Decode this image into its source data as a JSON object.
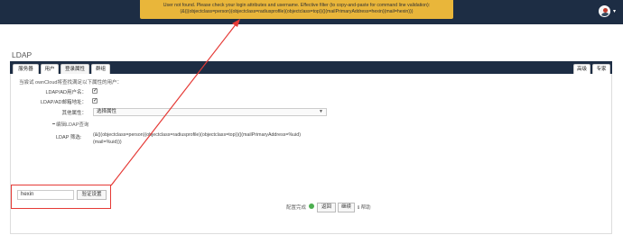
{
  "toast": {
    "line1": "User not found. Please check your login attributes and username. Effective filter (to copy-and-paste for command line validation):",
    "line2": "(&(|(objectclass=person)(objectclass=radiusprofile)(objectclass=top))(|(mailPrimaryAddress=hexin)(mail=hexin)))"
  },
  "header": {
    "user_caret": "▾"
  },
  "section": {
    "title": "LDAP"
  },
  "tabs": {
    "server": "服务器",
    "users": "用户",
    "login": "登录属性",
    "groups": "群组",
    "advanced": "高级",
    "expert": "专家"
  },
  "login_attrs": {
    "intro": "当尝试 ownCloud将查找满足以下属性的用户：",
    "ldap_ad_username_label": "LDAP/AD用户名：",
    "ldap_ad_username_checked": true,
    "ldap_ad_email_label": "LDAP/AD邮箱地址：",
    "ldap_ad_email_checked": true,
    "other_attrs_label": "其他属性：",
    "other_attrs_value": "选择属性",
    "edit_filter_link": "编辑LDAP查询",
    "ldap_filter_label": "LDAP 筛选:",
    "ldap_filter_line1": "(&(|(objectclass=person)(objectclass=radiusprofile)(objectclass=top))(|(mailPrimaryAddress=%uid)",
    "ldap_filter_line2": "(mail=%uid)))",
    "test_login_value": "hexin",
    "verify_button": "验证设置"
  },
  "footer": {
    "status_text": "配置完成",
    "back_button": "返回",
    "continue_button": "继续",
    "help_link": "帮助",
    "status_color": "#4caf50"
  },
  "colors": {
    "header_bg": "#1d2d44",
    "toast_bg": "#e9b63a",
    "annotation_red": "#e53935"
  }
}
